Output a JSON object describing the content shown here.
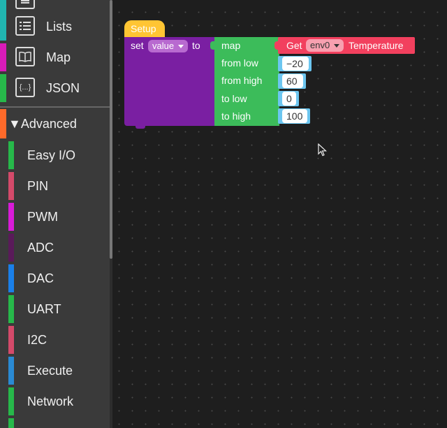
{
  "toolbox": {
    "categories": [
      {
        "label": "",
        "icon": "variables-icon",
        "color": "#21b5b0"
      },
      {
        "label": "Lists",
        "icon": "list-icon",
        "color": "#21b5b0"
      },
      {
        "label": "Map",
        "icon": "book-icon",
        "color": "#d81bb8"
      },
      {
        "label": "JSON",
        "icon": "braces-icon",
        "color": "#27b84a"
      }
    ],
    "advanced": {
      "label": "Advanced",
      "arrow": "▼",
      "color": "#ff6a2a"
    },
    "sub_items": [
      {
        "label": "Easy I/O",
        "color": "#27b84a"
      },
      {
        "label": "PIN",
        "color": "#d44a6a"
      },
      {
        "label": "PWM",
        "color": "#d81bd8"
      },
      {
        "label": "ADC",
        "color": "#5a1a5a"
      },
      {
        "label": "DAC",
        "color": "#1a7fe8"
      },
      {
        "label": "UART",
        "color": "#27b84a"
      },
      {
        "label": "I2C",
        "color": "#d44a6a"
      },
      {
        "label": "Execute",
        "color": "#2a8ad4"
      },
      {
        "label": "Network",
        "color": "#27b84a"
      },
      {
        "label": "",
        "color": "#27b84a"
      }
    ]
  },
  "blocks": {
    "setup_hat": "Setup",
    "set_label": "set",
    "var_name": "value",
    "to_label": "to",
    "map_label": "map",
    "from_low_label": "from low",
    "from_high_label": "from high",
    "to_low_label": "to low",
    "to_high_label": "to high",
    "from_low": "−20",
    "from_high": "60",
    "to_low": "0",
    "to_high": "100",
    "get_label": "Get",
    "sensor": "env0",
    "property": "Temperature",
    "colors": {
      "hat": "#ffc533",
      "variable": "#7a1fa2",
      "math": "#3cbc5a",
      "sensor": "#f2405e"
    }
  }
}
